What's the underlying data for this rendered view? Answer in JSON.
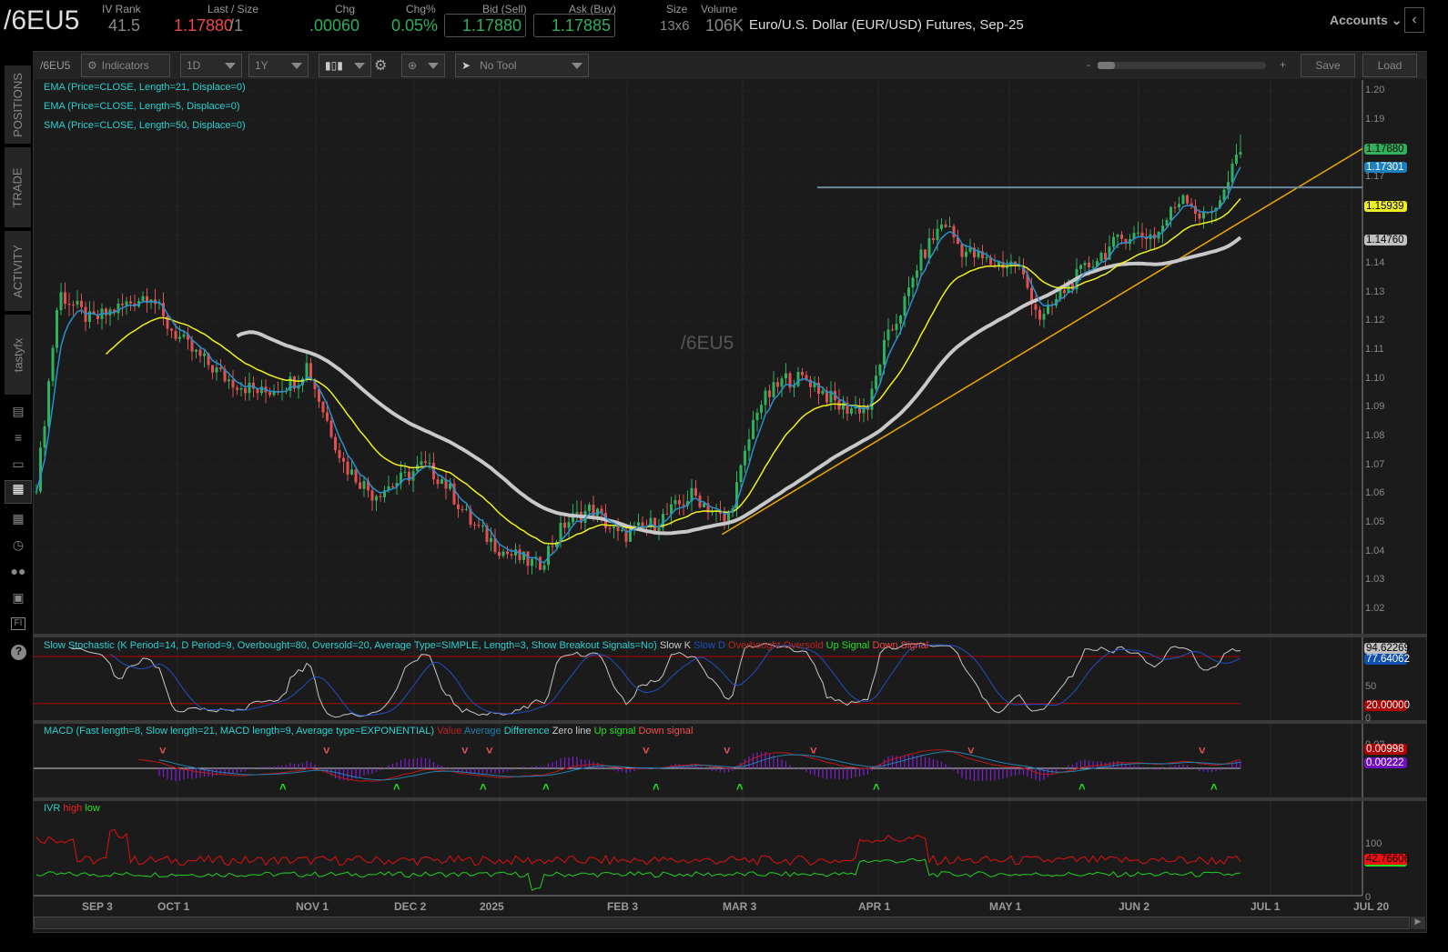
{
  "header": {
    "symbol": "/6EU5",
    "iv_rank_label": "IV Rank",
    "iv_rank": "41.5",
    "last_label": "Last / Size",
    "last": "1.17880",
    "size": "/1",
    "chg_label": "Chg",
    "chg": ".00060",
    "chgpct_label": "Chg%",
    "chgpct": "0.05%",
    "bid_label": "Bid (Sell)",
    "bid": "1.17880",
    "ask_label": "Ask (Buy)",
    "ask": "1.17885",
    "sizebook_label": "Size",
    "sizebook": "13x6",
    "volume_label": "Volume",
    "volume": "106K",
    "description": "Euro/U.S. Dollar (EUR/USD) Futures, Sep-25",
    "accounts": "Accounts"
  },
  "sidebar": {
    "tabs": [
      "POSITIONS",
      "TRADE",
      "ACTIVITY",
      "tastyfx"
    ],
    "icons": [
      "chart-book-icon",
      "list-icon",
      "tv-icon",
      "chart-grid-icon",
      "layout-icon",
      "clock-icon",
      "community-icon",
      "calendar-icon",
      "fi-icon",
      "help-icon"
    ],
    "fi": "FI",
    "help": "?"
  },
  "toolbar": {
    "symbol": "/6EU5",
    "indicators": "Indicators",
    "interval": "1D",
    "range": "1Y",
    "tool": "No Tool",
    "zoom_minus": "-",
    "zoom_plus": "+",
    "save": "Save",
    "load": "Load",
    "zoom_level": 0.08
  },
  "studies": [
    "EMA (Price=CLOSE, Length=21, Displace=0)",
    "EMA (Price=CLOSE, Length=5, Displace=0)",
    "SMA (Price=CLOSE, Length=50, Displace=0)"
  ],
  "watermark": "/6EU5",
  "price_axis": [
    "1.20",
    "1.19",
    "1.17",
    "1.16",
    "1.14",
    "1.13",
    "1.12",
    "1.11",
    "1.10",
    "1.09",
    "1.08",
    "1.07",
    "1.06",
    "1.05",
    "1.04",
    "1.03",
    "1.02"
  ],
  "price_badges": {
    "last": "1.17880",
    "ema5": "1.17301",
    "ema21": "1.15939",
    "sma50": "1.14760"
  },
  "stoch": {
    "title": "Slow Stochastic (K Period=14, D Period=9, Overbought=80, Oversold=20, Average Type=SIMPLE, Length=3, Show Breakout Signals=No)",
    "legend": [
      "Slow K",
      "Slow D",
      "Overbought",
      "Oversold",
      "Up Signal",
      "Down Signal"
    ],
    "axis": [
      "50",
      "0"
    ],
    "k": "94.62269",
    "d": "77.64062",
    "oversold": "20.00000"
  },
  "macd": {
    "title": "MACD (Fast length=8, Slow length=21, MACD length=9, Average type=EXPONENTIAL)",
    "legend": [
      "Value",
      "Average",
      "Difference",
      "Zero line",
      "Up signal",
      "Down signal"
    ],
    "axis": [
      "0.02"
    ],
    "value": "0.00998",
    "diff": "0.00222"
  },
  "ivr": {
    "title": "IVR",
    "legend": [
      "high",
      "low"
    ],
    "axis": [
      "100",
      "0"
    ],
    "value": "42.76606"
  },
  "x_axis": [
    "SEP 3",
    "OCT 1",
    "NOV 1",
    "DEC 2",
    "2025",
    "FEB 3",
    "MAR 3",
    "APR 1",
    "MAY 1",
    "JUN 2",
    "JUL 1",
    "JUL 20"
  ],
  "colors": {
    "up": "#2eb05c",
    "down": "#e05050",
    "ema5": "#2a8fd0",
    "ema21": "#f0f020",
    "sma50": "#c8c8c8",
    "trend": "#f0a800"
  },
  "chart_data": {
    "type": "candlestick",
    "title": "/6EU5 1D 1Y",
    "ylim": [
      1.02,
      1.2
    ],
    "approx_closes": [
      [
        "2024-08-15",
        1.105
      ],
      [
        "2024-08-18",
        1.13
      ],
      [
        "2024-08-30",
        1.12
      ],
      [
        "2024-09-21",
        1.13
      ],
      [
        "2024-09-26",
        1.12
      ],
      [
        "2024-10-04",
        1.11
      ],
      [
        "2024-10-12",
        1.1
      ],
      [
        "2024-10-20",
        1.095
      ],
      [
        "2024-10-28",
        1.1
      ],
      [
        "2024-10-30",
        1.105
      ],
      [
        "2024-11-03",
        1.09
      ],
      [
        "2024-11-10",
        1.07
      ],
      [
        "2024-11-19",
        1.06
      ],
      [
        "2024-11-28",
        1.065
      ],
      [
        "2024-12-05",
        1.07
      ],
      [
        "2024-12-12",
        1.065
      ],
      [
        "2024-12-22",
        1.05
      ],
      [
        "2025-01-02",
        1.04
      ],
      [
        "2025-01-11",
        1.035
      ],
      [
        "2025-01-18",
        1.05
      ],
      [
        "2025-01-25",
        1.055
      ],
      [
        "2025-02-01",
        1.045
      ],
      [
        "2025-02-10",
        1.05
      ],
      [
        "2025-02-19",
        1.06
      ],
      [
        "2025-02-27",
        1.05
      ],
      [
        "2025-03-03",
        1.07
      ],
      [
        "2025-03-06",
        1.09
      ],
      [
        "2025-03-12",
        1.1
      ],
      [
        "2025-03-17",
        1.1
      ],
      [
        "2025-03-24",
        1.09
      ],
      [
        "2025-03-30",
        1.09
      ],
      [
        "2025-04-02",
        1.11
      ],
      [
        "2025-04-08",
        1.13
      ],
      [
        "2025-04-10",
        1.14
      ],
      [
        "2025-04-16",
        1.155
      ],
      [
        "2025-04-20",
        1.145
      ],
      [
        "2025-04-27",
        1.14
      ],
      [
        "2025-05-03",
        1.14
      ],
      [
        "2025-05-09",
        1.12
      ],
      [
        "2025-05-14",
        1.13
      ],
      [
        "2025-05-21",
        1.14
      ],
      [
        "2025-05-30",
        1.15
      ],
      [
        "2025-06-06",
        1.15
      ],
      [
        "2025-06-12",
        1.165
      ],
      [
        "2025-06-16",
        1.155
      ],
      [
        "2025-06-21",
        1.165
      ],
      [
        "2025-06-24",
        1.1788
      ]
    ],
    "resistance": 1.1665,
    "trendline": [
      [
        "2025-02-26",
        1.046
      ],
      [
        "2025-07-20",
        1.18
      ]
    ]
  }
}
